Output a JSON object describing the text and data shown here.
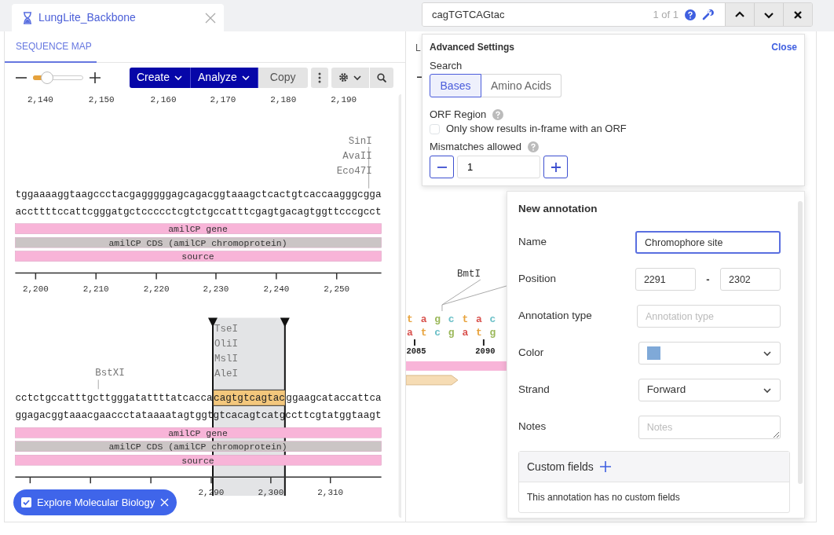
{
  "document_tab": {
    "title": "LungLite_Backbone"
  },
  "sequence_map": {
    "view_tab": {
      "label": "SEQUENCE MAP",
      "selected": true
    },
    "zoom": {
      "level": 0.28
    },
    "toolbar": [
      {
        "kind": "menu",
        "label": "Create"
      },
      {
        "kind": "menu",
        "label": "Analyze"
      },
      {
        "kind": "plain",
        "label": "Copy"
      },
      {
        "kind": "more"
      },
      {
        "kind": "settings"
      },
      {
        "kind": "search"
      }
    ],
    "top_ruler_labels": [
      "2,140",
      "2,150",
      "2,160",
      "2,170",
      "2,180",
      "2,190"
    ],
    "rows": [
      {
        "selected": false,
        "enzyme_groups": [
          [
            "SinI",
            "AvaII",
            "Eco47I"
          ]
        ],
        "top_strand": "tggaaaaggtaagccctacgagggggagcagacggtaaagctcactgtcaccaagggcgga",
        "bottom_strand": "accttttccattcgggatgctccccctcgtctgccatttcgagtgacagtggttcccgcct",
        "features": [
          {
            "label": "amilCP gene",
            "color": "#f8b4d8"
          },
          {
            "label": "amilCP CDS (amilCP chromoprotein)",
            "color": "#cbc5c5"
          },
          {
            "label": "source",
            "color": "#f8b4d8"
          }
        ],
        "ruler_labels": [
          "2,200",
          "2,210",
          "2,220",
          "2,230",
          "2,240",
          "2,250"
        ]
      },
      {
        "selected": true,
        "enzyme_groups": [
          [
            "BstXI"
          ],
          [
            "TseI",
            "OliI",
            "MslI",
            "AleI"
          ]
        ],
        "top_strand": "cctctgccatttgcttgggatattttatcaccacagtgtcagtacggaagcataccattca",
        "bottom_strand": "ggagacggtaaacgaaccctataaaatagtggtgtcacagtcatgccttcgtatggtaagt",
        "features": [
          {
            "label": "amilCP gene",
            "color": "#f8b4d8"
          },
          {
            "label": "amilCP CDS (amilCP chromoprotein)",
            "color": "#cbc5c5"
          },
          {
            "label": "source",
            "color": "#f8b4d8"
          }
        ],
        "ruler_labels": [
          "2,290",
          "2,300",
          "2,310"
        ]
      }
    ]
  },
  "background_map": {
    "tab_label": "L",
    "enzyme": "BmtI",
    "top_bases": [
      {
        "base": "t",
        "color": "#e8a33d"
      },
      {
        "base": "a",
        "color": "#d9534f"
      },
      {
        "base": "g",
        "color": "#9bb85a"
      },
      {
        "base": "c",
        "color": "#6cc0c8"
      },
      {
        "base": "t",
        "color": "#e8a33d"
      },
      {
        "base": "a",
        "color": "#d9534f"
      },
      {
        "base": "c",
        "color": "#6cc0c8"
      }
    ],
    "bottom_bases": [
      {
        "base": "a",
        "color": "#d9534f"
      },
      {
        "base": "t",
        "color": "#e8a33d"
      },
      {
        "base": "c",
        "color": "#6cc0c8"
      },
      {
        "base": "g",
        "color": "#9bb85a"
      },
      {
        "base": "a",
        "color": "#d9534f"
      },
      {
        "base": "t",
        "color": "#e8a33d"
      },
      {
        "base": "g",
        "color": "#9bb85a"
      }
    ],
    "ruler_labels": [
      "2085",
      "2090"
    ],
    "features": [
      {
        "kind": "bar",
        "color": "#f8b4d8"
      },
      {
        "kind": "arrow",
        "color": "#f6dcb4"
      }
    ]
  },
  "search_bar": {
    "query": "cagTGTCAGtac",
    "match_count": "1 of 1"
  },
  "advanced_settings": {
    "title": "Advanced Settings",
    "close": "Close",
    "search_label": "Search",
    "search_modes": [
      {
        "label": "Bases",
        "selected": true
      },
      {
        "label": "Amino Acids",
        "selected": false
      }
    ],
    "orf_label": "ORF Region",
    "orf_option": {
      "label": "Only show results in-frame with an ORF",
      "checked": false
    },
    "mismatch_label": "Mismatches allowed",
    "mismatches": "1"
  },
  "annotation_form": {
    "title": "New annotation",
    "fields": [
      {
        "kind": "text",
        "label": "Name",
        "value": "Chromophore site",
        "focused": true
      },
      {
        "kind": "range",
        "label": "Position",
        "from": "2291",
        "separator": "-",
        "to": "2302",
        "focused": false
      },
      {
        "kind": "text",
        "label": "Annotation type",
        "placeholder": "Annotation type",
        "focused": false
      },
      {
        "kind": "color",
        "label": "Color",
        "color": "#7fa9d8",
        "focused": false
      },
      {
        "kind": "select",
        "label": "Strand",
        "value": "Forward",
        "focused": false
      },
      {
        "kind": "textarea",
        "label": "Notes",
        "placeholder": "Notes",
        "focused": false
      }
    ],
    "custom_fields": {
      "title": "Custom fields",
      "empty_text": "This annotation has no custom fields"
    }
  },
  "explore_banner": {
    "label": "Explore Molecular Biology",
    "checked": true
  }
}
